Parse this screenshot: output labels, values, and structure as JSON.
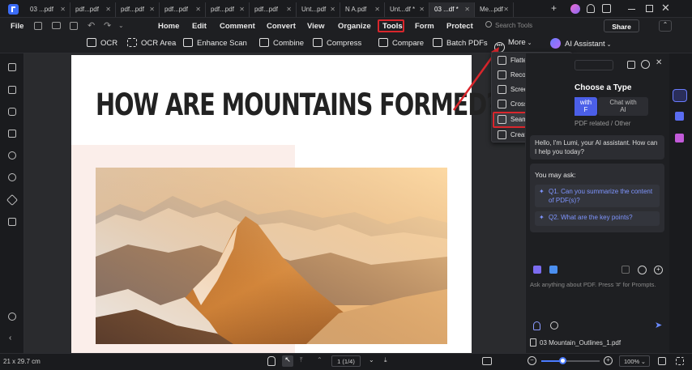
{
  "tabs": [
    {
      "label": "03 ...pdf",
      "active": false
    },
    {
      "label": "pdf...pdf",
      "active": false
    },
    {
      "label": "pdf...pdf",
      "active": false
    },
    {
      "label": "pdf...pdf",
      "active": false
    },
    {
      "label": "pdf...pdf",
      "active": false
    },
    {
      "label": "pdf...pdf",
      "active": false
    },
    {
      "label": "Unt...pdf",
      "active": false
    },
    {
      "label": "N A.pdf",
      "active": false
    },
    {
      "label": "Unt...df *",
      "active": false
    },
    {
      "label": "03 ...df *",
      "active": true
    },
    {
      "label": "Me...pdf",
      "active": false
    }
  ],
  "menu": {
    "file": "File",
    "items": [
      "Home",
      "Edit",
      "Comment",
      "Convert",
      "View",
      "Organize",
      "Tools",
      "Form",
      "Protect"
    ],
    "active": "Tools",
    "search_placeholder": "Search Tools",
    "share": "Share"
  },
  "toolbar": {
    "ocr": "OCR",
    "ocr_area": "OCR Area",
    "enhance_scan": "Enhance Scan",
    "combine": "Combine",
    "compress": "Compress",
    "compare": "Compare",
    "batch_pdfs": "Batch PDFs",
    "more": "More",
    "ai_assistant": "AI Assistant"
  },
  "dropdown": {
    "items": [
      "Flatten PDF",
      "Recognize Table",
      "Screenshot",
      "Cross Merge",
      "Seam Seal",
      "Create Outlines"
    ],
    "highlighted": "Seam Seal"
  },
  "document": {
    "heading": "HOW ARE MOUNTAINS FORMED?"
  },
  "ai_panel": {
    "choose_type": "Choose a Type",
    "chat_with_pdf_partial": "with\nF",
    "chat_with_ai": "Chat with\nAI",
    "pdf_related": "PDF related / Other",
    "greeting": "Hello, I'm Lumi, your AI assistant. How can I help you today?",
    "you_may_ask": "You may ask:",
    "q1": "Q1. Can you summarize the content of PDF(s)?",
    "q2": "Q2. What are the key points?",
    "input_placeholder": "Ask anything about PDF. Press '#' for Prompts.",
    "file_name": "03 Mountain_Outlines_1.pdf"
  },
  "status": {
    "page_size": "21 x 29.7 cm",
    "page_indicator": "1 (1/4)",
    "zoom": "100%"
  },
  "colors": {
    "accent": "#4b5fe8",
    "highlight_red": "#d9262c"
  }
}
